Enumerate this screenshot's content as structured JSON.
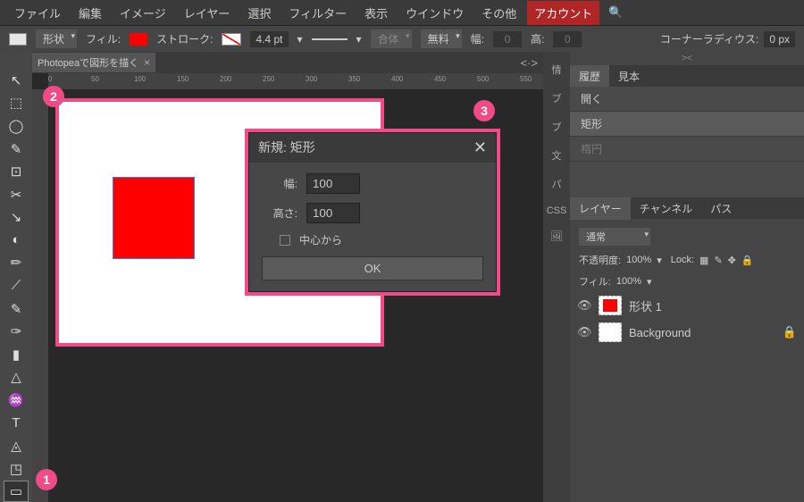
{
  "menu": [
    "ファイル",
    "編集",
    "イメージ",
    "レイヤー",
    "選択",
    "フィルター",
    "表示",
    "ウインドウ",
    "その他"
  ],
  "menu_account": "アカウント",
  "optbar": {
    "shape_mode": "形状",
    "fill_label": "フィル:",
    "fill_color": "#ff0000",
    "stroke_label": "ストローク:",
    "stroke_width": "4.4 pt",
    "combine": "合体",
    "free": "無料",
    "w_label": "幅:",
    "w_val": "0",
    "h_label": "高:",
    "h_val": "0",
    "corner_label": "コーナーラディウス:",
    "corner_val": "0 px"
  },
  "tab": {
    "title": "Photopeaで図形を描く",
    "close": "×"
  },
  "ruler_marks": [
    "0",
    "50",
    "100",
    "150",
    "200",
    "250",
    "300",
    "350",
    "400",
    "450",
    "500",
    "550"
  ],
  "tools": [
    "↖",
    "⬚",
    "◯",
    "✎",
    "⊡",
    "✂",
    "↘",
    "◐",
    "✏",
    "⟋",
    "✎",
    "✑",
    "▮",
    "△",
    "♒",
    "T",
    "◬",
    "◳"
  ],
  "rect_tool": "▭",
  "rightcol": [
    "情",
    "ブ",
    "ブ",
    "文",
    "パ",
    "CSS",
    "🖼"
  ],
  "history_tabs": [
    "履歴",
    "見本"
  ],
  "history": [
    {
      "label": "開く",
      "active": false,
      "dim": false
    },
    {
      "label": "矩形",
      "active": true,
      "dim": false
    },
    {
      "label": "楕円",
      "active": false,
      "dim": true
    }
  ],
  "layer_tabs": [
    "レイヤー",
    "チャンネル",
    "パス"
  ],
  "layer_opts": {
    "blend": "通常",
    "opacity_label": "不透明度:",
    "opacity": "100%",
    "lock_label": "Lock:",
    "fill_label": "フィル:",
    "fill": "100%"
  },
  "layers": [
    {
      "name": "形状 1",
      "thumb": "red",
      "locked": false
    },
    {
      "name": "Background",
      "thumb": "white",
      "locked": true
    }
  ],
  "dialog": {
    "title": "新規: 矩形",
    "width_label": "幅:",
    "width_val": "100",
    "height_label": "高さ:",
    "height_val": "100",
    "center_label": "中心から",
    "ok": "OK"
  },
  "annots": {
    "a1": "1",
    "a2": "2",
    "a3": "3"
  }
}
